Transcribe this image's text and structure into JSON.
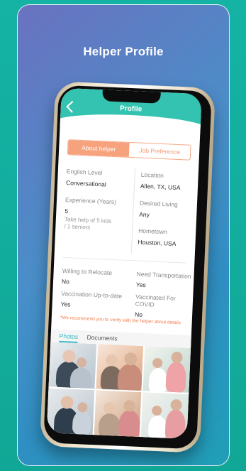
{
  "card": {
    "title": "Helper Profile"
  },
  "app": {
    "header_title": "Profile",
    "segments": [
      {
        "label": "About helper",
        "active": true
      },
      {
        "label": "Job Preference",
        "active": false
      }
    ],
    "left": {
      "english_label": "English Level",
      "english_value": "Conversational",
      "experience_label": "Experience (Years)",
      "experience_value": "5",
      "experience_note_1": "Take help of 5 kids",
      "experience_note_2": "/ 1 seniors"
    },
    "right": {
      "location_label": "Location",
      "location_value": "Allen, TX, USA",
      "desired_label": "Desired Living",
      "desired_value": "Any",
      "hometown_label": "Hometown",
      "hometown_value": "Houston, USA"
    },
    "bottom": {
      "relocate_label": "Willing to Relocate",
      "relocate_value": "No",
      "transport_label": "Need Transportation",
      "transport_value": "Yes",
      "vacc_label": "Vaccination Up-to-date",
      "vacc_value": "Yes",
      "covid_label": "Vaccinated For COVID",
      "covid_value": "No"
    },
    "note": "*We recommend you to verify with the helper about details",
    "tabs": [
      {
        "label": "Photos",
        "active": true
      },
      {
        "label": "Documents",
        "active": false
      }
    ]
  },
  "colors": {
    "accent_teal": "#34c3b0",
    "accent_orange": "#f6a27c",
    "tab_active": "#34b8c4",
    "note_red": "#f07d4f"
  }
}
